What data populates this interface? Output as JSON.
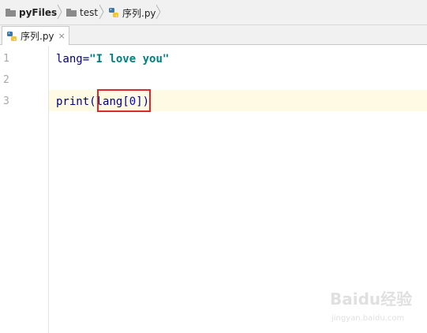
{
  "breadcrumb": {
    "items": [
      {
        "label": "pyFiles",
        "icon": "folder-icon"
      },
      {
        "label": "test",
        "icon": "folder-icon"
      },
      {
        "label": "序列.py",
        "icon": "python-file-icon"
      }
    ]
  },
  "tabs": [
    {
      "label": "序列.py",
      "close": "×",
      "icon": "python-file-icon"
    }
  ],
  "editor": {
    "line_numbers": [
      "1",
      "2",
      "3"
    ],
    "lines": {
      "l1_var": "lang=",
      "l1_str": "\"I love you\"",
      "l3_func": "print",
      "l3_open": "(",
      "l3_arg": "lang",
      "l3_lbr": "[",
      "l3_idx": "0",
      "l3_rbr": "]",
      "l3_close": ")"
    },
    "current_line": "3"
  },
  "watermark": {
    "brand": "Baidu经验",
    "url": "jingyan.baidu.com"
  },
  "colors": {
    "highlight_box": "#e0282a",
    "string": "#008080",
    "keyword": "#000080",
    "current_line_bg": "#fffae3"
  }
}
